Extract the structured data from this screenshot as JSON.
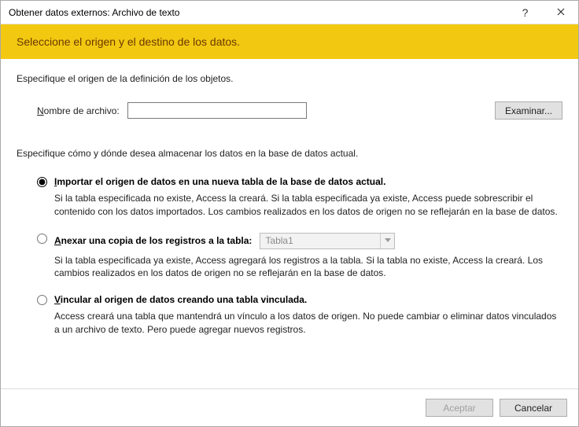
{
  "window": {
    "title": "Obtener datos externos: Archivo de texto",
    "help_icon": "?",
    "close_icon": "✕"
  },
  "banner": {
    "heading": "Seleccione el origen y el destino de los datos."
  },
  "source": {
    "heading": "Especifique el origen de la definición de los objetos.",
    "filename_label_pre": "N",
    "filename_label_rest": "ombre de archivo:",
    "filename_value": "",
    "browse_label": "Examinar..."
  },
  "storage": {
    "heading": "Especifique cómo y dónde desea almacenar los datos en la base de datos actual.",
    "options": [
      {
        "key": "import",
        "title_ul": "I",
        "title_rest": "mportar el origen de datos en una nueva tabla de la base de datos actual.",
        "desc": "Si la tabla especificada no existe, Access la creará. Si la tabla especificada ya existe, Access puede sobrescribir el contenido con los datos importados. Los cambios realizados en los datos de origen no se reflejarán en la base de datos.",
        "selected": true
      },
      {
        "key": "append",
        "title_ul": "A",
        "title_rest": "nexar una copia de los registros a la tabla:",
        "combo_value": "Tabla1",
        "desc": "Si la tabla especificada ya existe, Access agregará los registros a la tabla. Si la tabla no existe, Access la creará. Los cambios realizados en los datos de origen no se reflejarán en la base de datos.",
        "selected": false
      },
      {
        "key": "link",
        "title_ul": "V",
        "title_rest": "incular al origen de datos creando una tabla vinculada.",
        "desc": "Access creará una tabla que mantendrá un vínculo a los datos de origen. No puede cambiar o eliminar datos vinculados a un archivo de texto. Pero puede agregar nuevos registros.",
        "selected": false
      }
    ]
  },
  "footer": {
    "ok_label": "Aceptar",
    "cancel_label": "Cancelar"
  }
}
